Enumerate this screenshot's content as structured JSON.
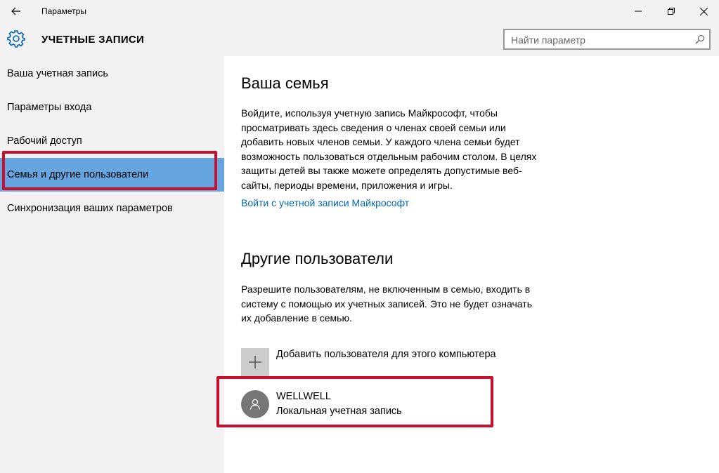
{
  "window": {
    "title": "Параметры"
  },
  "header": {
    "section_title": "УЧЕТНЫЕ ЗАПИСИ",
    "search_placeholder": "Найти параметр"
  },
  "sidebar": {
    "items": [
      {
        "label": "Ваша учетная запись"
      },
      {
        "label": "Параметры входа"
      },
      {
        "label": "Рабочий доступ"
      },
      {
        "label": "Семья и другие пользователи",
        "selected": true
      },
      {
        "label": "Синхронизация ваших параметров"
      }
    ]
  },
  "main": {
    "family": {
      "heading": "Ваша семья",
      "lines": [
        "Войдите, используя учетную запись Майкрософт, чтобы",
        "просматривать здесь сведения о членах своей семьи или",
        "добавить новых членов семьи. У каждого члена семьи будет",
        "возможность пользоваться отдельным рабочим столом. В целях",
        "защиты детей вы также можете определять допустимые веб-",
        "сайты, периоды времени, приложения и игры."
      ],
      "link": "Войти с учетной записи Майкрософт"
    },
    "others": {
      "heading": "Другие пользователи",
      "lines": [
        "Разрешите пользователям, не включенным в семью, входить в",
        "систему с помощью их учетных записей. Это не будет означать",
        "их добавление в семью."
      ],
      "add_label": "Добавить пользователя для этого компьютера",
      "user": {
        "name": "WELLWELL",
        "account_type": "Локальная учетная запись"
      }
    }
  },
  "colors": {
    "accent": "#66a6e0",
    "link": "#0067b8",
    "highlight": "#c8102e",
    "sidebar_bg": "#f2f2f2"
  },
  "icons": {
    "back": "back-arrow-icon",
    "settings": "gear-icon",
    "search": "search-icon",
    "minimize": "minimize-icon",
    "maximize": "restore-icon",
    "close": "close-icon",
    "add": "plus-icon",
    "user": "person-icon"
  }
}
